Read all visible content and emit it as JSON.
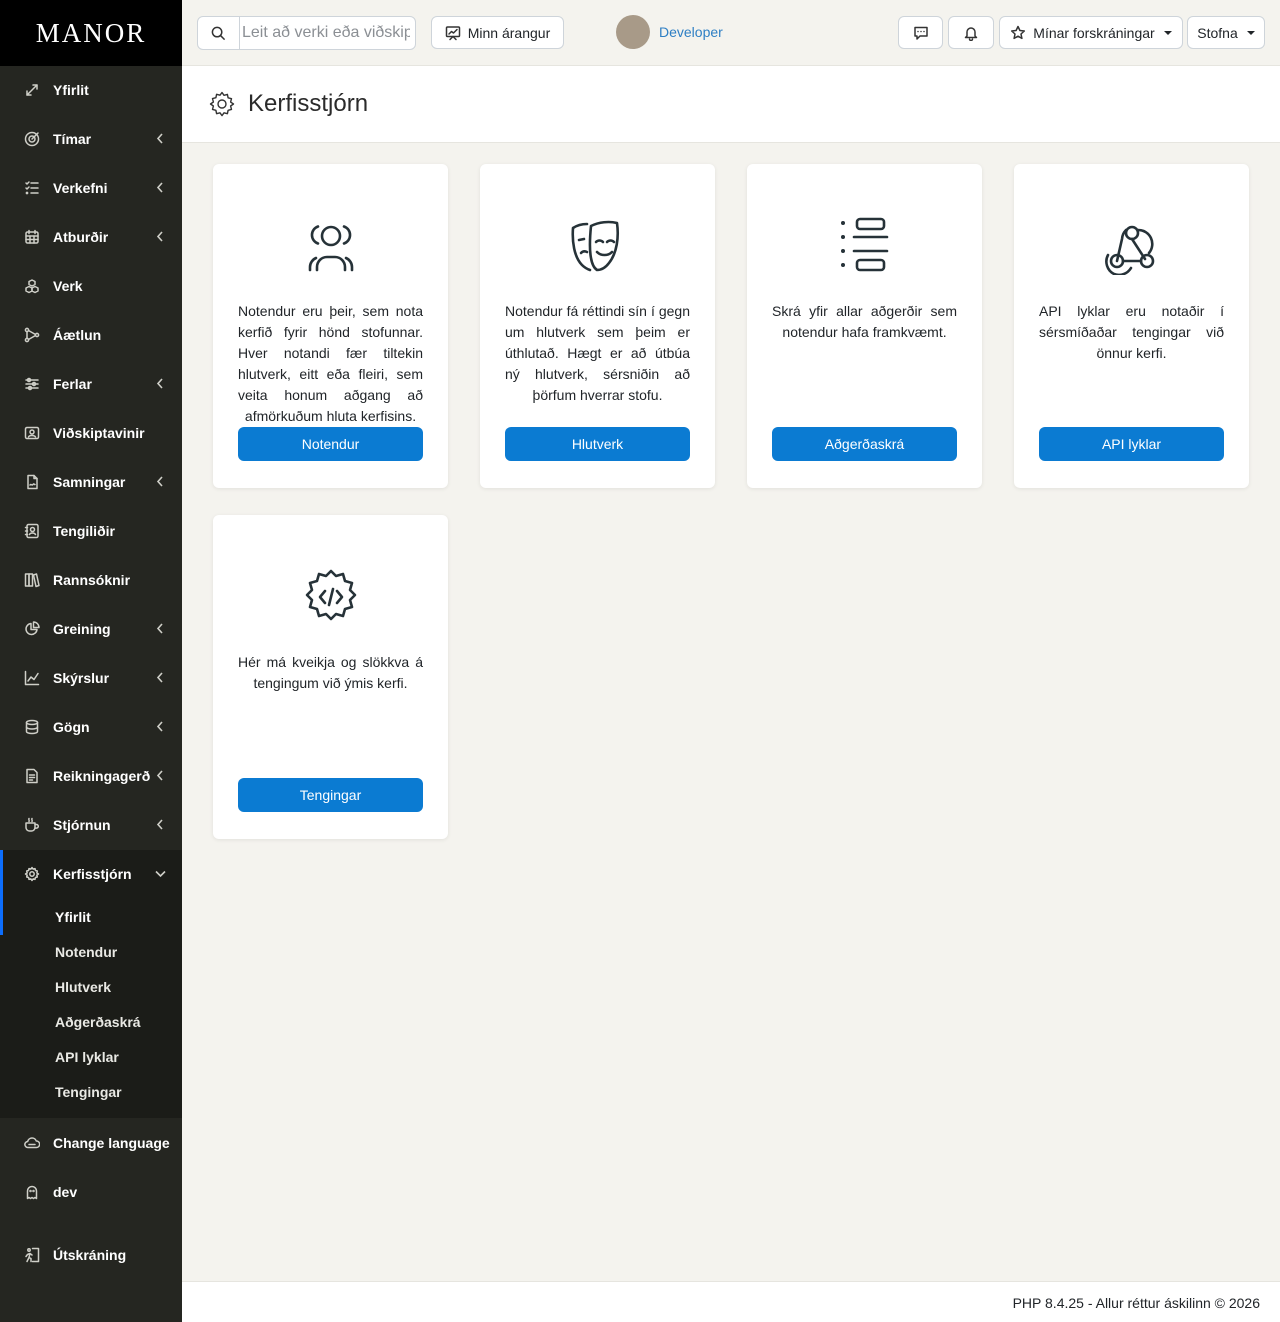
{
  "brand": {
    "logo_text": "MANOR"
  },
  "sidebar": {
    "items": [
      {
        "label": "Yfirlit",
        "icon": "gauge-icon",
        "chevron": false
      },
      {
        "label": "Tímar",
        "icon": "target-icon",
        "chevron": true
      },
      {
        "label": "Verkefni",
        "icon": "checklist-icon",
        "chevron": true
      },
      {
        "label": "Atburðir",
        "icon": "calendar-icon",
        "chevron": true
      },
      {
        "label": "Verk",
        "icon": "cubes-icon",
        "chevron": false
      },
      {
        "label": "Áætlun",
        "icon": "hierarchy-icon",
        "chevron": false
      },
      {
        "label": "Ferlar",
        "icon": "sliders-icon",
        "chevron": true
      },
      {
        "label": "Viðskiptavinir",
        "icon": "user-card-icon",
        "chevron": false
      },
      {
        "label": "Samningar",
        "icon": "contract-icon",
        "chevron": true
      },
      {
        "label": "Tengiliðir",
        "icon": "contact-icon",
        "chevron": false
      },
      {
        "label": "Rannsóknir",
        "icon": "books-icon",
        "chevron": false
      },
      {
        "label": "Greining",
        "icon": "pie-chart-icon",
        "chevron": true
      },
      {
        "label": "Skýrslur",
        "icon": "line-chart-icon",
        "chevron": true
      },
      {
        "label": "Gögn",
        "icon": "database-icon",
        "chevron": true
      },
      {
        "label": "Reikningagerð",
        "icon": "invoice-icon",
        "chevron": true
      },
      {
        "label": "Stjórnun",
        "icon": "coffee-icon",
        "chevron": true
      },
      {
        "label": "Kerfisstjórn",
        "icon": "gear-icon",
        "chevron": true,
        "expanded": true
      }
    ],
    "sub_items": [
      {
        "label": "Yfirlit",
        "current": true
      },
      {
        "label": "Notendur"
      },
      {
        "label": "Hlutverk"
      },
      {
        "label": "Aðgerðaskrá"
      },
      {
        "label": "API lyklar"
      },
      {
        "label": "Tengingar"
      }
    ],
    "bottom_items": [
      {
        "label": "Change language",
        "icon": "cloud-icon"
      },
      {
        "label": "dev",
        "icon": "ghost-icon"
      },
      {
        "label": "Útskráning",
        "icon": "logout-icon"
      }
    ]
  },
  "topbar": {
    "search_placeholder": "Leit að verki eða viðskiptavini",
    "achievement_label": "Minn árangur",
    "user_name": "Developer",
    "favorites_label": "Mínar forskráningar",
    "create_label": "Stofna"
  },
  "page": {
    "title": "Kerfisstjórn"
  },
  "cards": [
    {
      "text": "Notendur eru þeir, sem nota kerfið fyrir hönd stofunnar. Hver notandi fær tiltekin hlutverk, eitt eða fleiri, sem veita honum aðgang að afmörkuðum hluta kerfisins.",
      "button": "Notendur",
      "icon": "users-icon"
    },
    {
      "text": "Notendur fá réttindi sín í gegn um hlutverk sem þeim er úthlutað. Hægt er að útbúa ný hlutverk, sérsniðin að þörfum hverrar stofu.",
      "button": "Hlutverk",
      "icon": "theater-masks-icon"
    },
    {
      "text": "Skrá yfir allar aðgerðir sem notendur hafa framkvæmt.",
      "button": "Aðgerðaskrá",
      "icon": "list-details-icon"
    },
    {
      "text": "API lyklar eru notaðir í sérsmíðaðar tengingar við önnur kerfi.",
      "button": "API lyklar",
      "icon": "webhook-icon"
    },
    {
      "text": "Hér má kveikja og slökkva á tengingum við ýmis kerfi.",
      "button": "Tengingar",
      "icon": "code-gear-icon"
    }
  ],
  "footer": {
    "text": "PHP 8.4.25 - Allur réttur áskilinn © 2026"
  },
  "colors": {
    "sidebar_bg": "#252621",
    "accent": "#0b7bd2",
    "active_bar": "#0d6efd",
    "page_bg": "#f4f3ee"
  }
}
